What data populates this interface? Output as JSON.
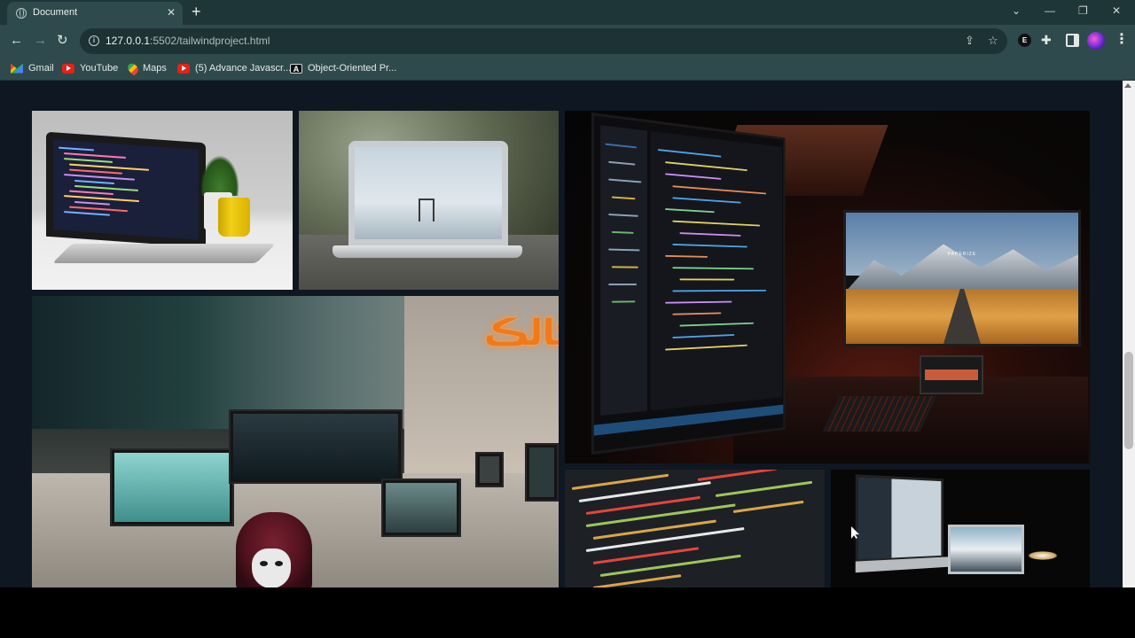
{
  "browser": {
    "tab": {
      "title": "Document",
      "close": "✕"
    },
    "new_tab": "+",
    "window_controls": {
      "dropdown": "⌄",
      "minimize": "—",
      "restore": "❐",
      "close": "✕"
    },
    "nav": {
      "back": "←",
      "forward": "→",
      "reload": "↻"
    },
    "address": {
      "host": "127.0.0.1",
      "rest": ":5502/tailwindproject.html"
    },
    "ext_e_label": "E",
    "bookmarks": [
      {
        "label": "Gmail",
        "icon": "gmail-icon"
      },
      {
        "label": "YouTube",
        "icon": "youtube-icon"
      },
      {
        "label": "Maps",
        "icon": "maps-icon"
      },
      {
        "label": "(5) Advance Javascr...",
        "icon": "youtube-icon"
      },
      {
        "label": "Object-Oriented Pr...",
        "icon": "a-logo-icon"
      }
    ]
  },
  "page": {
    "background": "#0f1722",
    "gallery": [
      {
        "name": "laptop-white-desk-photo"
      },
      {
        "name": "laptop-outdoors-photo"
      },
      {
        "name": "dual-monitor-setup-photo",
        "monitor_text": "PAPERIZE"
      },
      {
        "name": "office-hacker-photo",
        "sign_text": "ڪالڪ"
      },
      {
        "name": "code-closeup-photo"
      },
      {
        "name": "dark-desk-monitors-photo"
      }
    ]
  }
}
